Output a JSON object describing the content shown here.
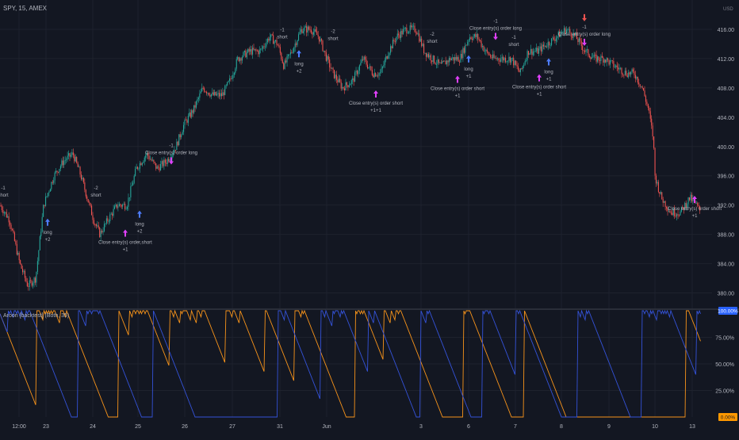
{
  "header": {
    "symbol_label": "SPY, 15, AMEX",
    "settings_label": "USD"
  },
  "indicator": {
    "label": "Aroon [backtest] (Both, 35)"
  },
  "colors": {
    "background": "#131722",
    "grid": "#1e222d",
    "up": "#26a69a",
    "down": "#ef5350",
    "aroon_up": "#f7931a",
    "aroon_down": "#3452d8",
    "long_arrow": "#4d7cfe",
    "close_arrow": "#e040fb",
    "text": "#b2b5be",
    "badge_up": "#2962ff",
    "badge_down": "#ff9800"
  },
  "chart_data": [
    {
      "type": "candlestick",
      "title": "",
      "y_axis_ticks": [
        "416.00",
        "412.00",
        "408.00",
        "404.00",
        "400.00",
        "396.00",
        "392.00",
        "388.00",
        "384.00",
        "380.00"
      ],
      "ylim": [
        378,
        420
      ],
      "x_axis_ticks": [
        "12:00",
        "23",
        "24",
        "25",
        "26",
        "27",
        "31",
        "Jun",
        "3",
        "6",
        "7",
        "8",
        "9",
        "10",
        "13"
      ],
      "bars": 620,
      "close_path": [
        [
          0,
          392
        ],
        [
          12,
          390
        ],
        [
          25,
          384
        ],
        [
          35,
          381
        ],
        [
          45,
          382
        ],
        [
          55,
          392
        ],
        [
          68,
          396
        ],
        [
          80,
          398
        ],
        [
          92,
          399
        ],
        [
          102,
          396
        ],
        [
          110,
          393
        ],
        [
          118,
          390
        ],
        [
          126,
          388
        ],
        [
          136,
          390
        ],
        [
          148,
          392
        ],
        [
          160,
          392
        ],
        [
          172,
          397
        ],
        [
          185,
          399
        ],
        [
          198,
          397
        ],
        [
          210,
          398
        ],
        [
          222,
          400
        ],
        [
          232,
          403
        ],
        [
          244,
          405
        ],
        [
          256,
          408
        ],
        [
          268,
          407
        ],
        [
          280,
          407
        ],
        [
          290,
          409
        ],
        [
          300,
          412
        ],
        [
          315,
          413
        ],
        [
          328,
          413
        ],
        [
          340,
          415
        ],
        [
          350,
          414
        ],
        [
          358,
          411
        ],
        [
          368,
          413
        ],
        [
          380,
          416
        ],
        [
          392,
          416
        ],
        [
          402,
          415
        ],
        [
          412,
          412
        ],
        [
          420,
          410
        ],
        [
          432,
          408
        ],
        [
          445,
          409
        ],
        [
          458,
          412
        ],
        [
          470,
          410
        ],
        [
          480,
          410
        ],
        [
          490,
          413
        ],
        [
          500,
          415
        ],
        [
          512,
          416
        ],
        [
          525,
          416
        ],
        [
          535,
          413
        ],
        [
          545,
          412
        ],
        [
          556,
          411
        ],
        [
          568,
          412
        ],
        [
          580,
          412
        ],
        [
          592,
          415
        ],
        [
          602,
          415
        ],
        [
          612,
          413
        ],
        [
          622,
          412
        ],
        [
          634,
          412
        ],
        [
          645,
          412
        ],
        [
          656,
          410
        ],
        [
          666,
          413
        ],
        [
          678,
          413
        ],
        [
          690,
          414
        ],
        [
          702,
          415
        ],
        [
          714,
          416
        ],
        [
          726,
          415
        ],
        [
          738,
          413
        ],
        [
          750,
          412
        ],
        [
          762,
          412
        ],
        [
          775,
          411
        ],
        [
          790,
          410
        ],
        [
          800,
          410
        ],
        [
          810,
          408
        ],
        [
          818,
          405
        ],
        [
          824,
          401
        ],
        [
          826,
          396
        ],
        [
          834,
          393
        ],
        [
          846,
          391
        ],
        [
          858,
          391
        ],
        [
          870,
          393
        ],
        [
          878,
          392
        ],
        [
          884,
          391
        ]
      ]
    },
    {
      "type": "line",
      "title": "",
      "ylim": [
        0,
        100
      ],
      "y_axis_ticks": [
        "75.00%",
        "50.00%",
        "25.00%"
      ],
      "series": [
        {
          "line": "up",
          "last_value": "0.00%"
        },
        {
          "line": "down",
          "last_value": "100.00%"
        }
      ]
    }
  ],
  "annotations": [
    {
      "lines": [
        "-1",
        "short"
      ],
      "x": 4,
      "y": 392.6,
      "dir": "down"
    },
    {
      "lines": [
        "long",
        "+2"
      ],
      "x": 60,
      "y": 389.5,
      "dir": "up"
    },
    {
      "lines": [
        "-2",
        "short"
      ],
      "x": 121,
      "y": 392.6,
      "dir": "down"
    },
    {
      "lines": [
        "Close entry(s) order,short",
        "+1"
      ],
      "x": 158,
      "y": 387.8,
      "dir": "close"
    },
    {
      "lines": [
        "long",
        "+2"
      ],
      "x": 176,
      "y": 390.6,
      "dir": "up"
    },
    {
      "lines": [
        "-1",
        "Close entry(s) order long"
      ],
      "x": 216,
      "y": 398.4,
      "dir": "closedown"
    },
    {
      "lines": [
        "-1",
        "short"
      ],
      "x": 356,
      "y": 414.2,
      "dir": "down"
    },
    {
      "lines": [
        "long",
        "+2"
      ],
      "x": 377,
      "y": 412.5,
      "dir": "up"
    },
    {
      "lines": [
        "-2",
        "short"
      ],
      "x": 420,
      "y": 414.0,
      "dir": "down"
    },
    {
      "lines": [
        "Close entry(s) order short",
        "+1+1"
      ],
      "x": 474,
      "y": 406.8,
      "dir": "close"
    },
    {
      "lines": [
        "-2",
        "short"
      ],
      "x": 545,
      "y": 413.6,
      "dir": "down"
    },
    {
      "lines": [
        "long",
        "+1"
      ],
      "x": 591,
      "y": 411.8,
      "dir": "up"
    },
    {
      "lines": [
        "Close entry(s) order short",
        "+1"
      ],
      "x": 577,
      "y": 408.8,
      "dir": "close"
    },
    {
      "lines": [
        "-1",
        "Close entry(s) order long"
      ],
      "x": 625,
      "y": 415.4,
      "dir": "closedown"
    },
    {
      "lines": [
        "-1",
        "short"
      ],
      "x": 648,
      "y": 413.2,
      "dir": "down"
    },
    {
      "lines": [
        "long",
        "+1"
      ],
      "x": 692,
      "y": 411.4,
      "dir": "up"
    },
    {
      "lines": [
        "Close entry(s) order short",
        "+1"
      ],
      "x": 680,
      "y": 409.0,
      "dir": "close"
    },
    {
      "lines": [
        "short"
      ],
      "x": 737,
      "y": 418.6,
      "dir": "down"
    },
    {
      "lines": [
        "-1",
        "Close entry(s) order long"
      ],
      "x": 737,
      "y": 414.6,
      "dir": "closedown"
    },
    {
      "lines": [
        "Close entry(s) order short",
        "+1"
      ],
      "x": 876,
      "y": 392.4,
      "dir": "close"
    }
  ]
}
